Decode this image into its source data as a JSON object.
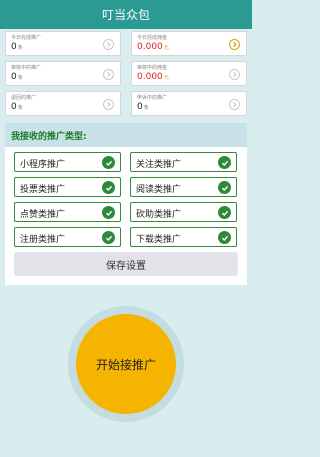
{
  "header": {
    "title": "叮当众包"
  },
  "stats": [
    {
      "label": "今日完成推广",
      "value": "0",
      "unit": "条",
      "style": "normal",
      "icon": "chevron-right-icon"
    },
    {
      "label": "今日完成佣金",
      "value": "0.000",
      "unit": "元",
      "style": "red",
      "icon": "chevron-right-icon"
    },
    {
      "label": "审核中的推广",
      "value": "0",
      "unit": "条",
      "style": "normal",
      "icon": "chevron-right-icon"
    },
    {
      "label": "审核中的佣金",
      "value": "0.000",
      "unit": "元",
      "style": "red",
      "icon": "chevron-right-icon"
    },
    {
      "label": "退回的推广",
      "value": "0",
      "unit": "条",
      "style": "normal",
      "icon": "chevron-right-icon"
    },
    {
      "label": "申诉中的推广",
      "value": "0",
      "unit": "条",
      "style": "normal",
      "icon": "chevron-right-icon"
    }
  ],
  "types": {
    "title": "我接收的推广类型:",
    "items": [
      {
        "label": "小程序推广",
        "checked": true
      },
      {
        "label": "关注类推广",
        "checked": true
      },
      {
        "label": "投票类推广",
        "checked": true
      },
      {
        "label": "阅读类推广",
        "checked": true
      },
      {
        "label": "点赞类推广",
        "checked": true
      },
      {
        "label": "砍助类推广",
        "checked": true
      },
      {
        "label": "注册类推广",
        "checked": true
      },
      {
        "label": "下载类推广",
        "checked": true
      }
    ],
    "save_label": "保存设置"
  },
  "start": {
    "label": "开始接推广"
  },
  "colors": {
    "header": "#2a9a93",
    "accent_green": "#2e8a3a",
    "money_red": "#e02020",
    "start_yellow": "#f5b400"
  }
}
